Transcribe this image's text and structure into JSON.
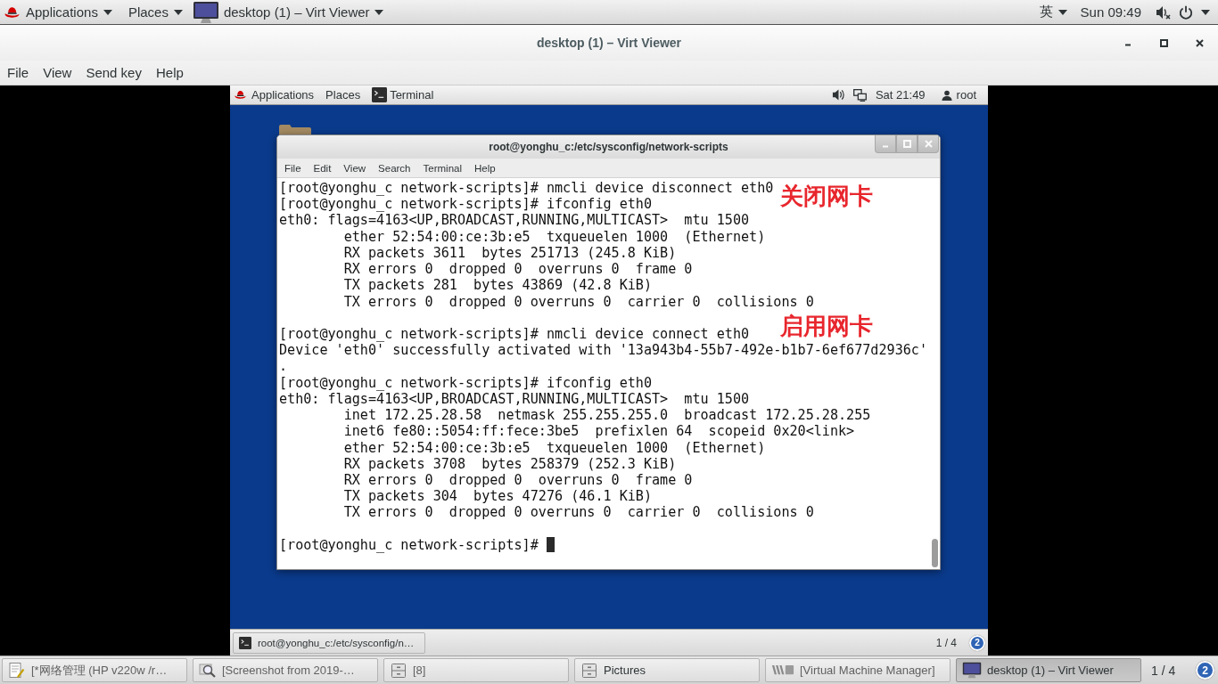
{
  "top_bar": {
    "menus": [
      {
        "label": "Applications"
      },
      {
        "label": "Places"
      }
    ],
    "app_menu": "desktop (1) – Virt Viewer",
    "input_method": "英",
    "clock": "Sun 09:49"
  },
  "window": {
    "title": "desktop (1) – Virt Viewer",
    "menu": [
      "File",
      "View",
      "Send key",
      "Help"
    ]
  },
  "guest": {
    "top_bar": {
      "menus": [
        {
          "label": "Applications"
        },
        {
          "label": "Places"
        }
      ],
      "app_menu": "Terminal",
      "clock": "Sat 21:49",
      "user": "root"
    },
    "terminal": {
      "title": "root@yonghu_c:/etc/sysconfig/network-scripts",
      "menu": [
        "File",
        "Edit",
        "View",
        "Search",
        "Terminal",
        "Help"
      ],
      "blocks": [
        [
          {
            "text": "[root@yonghu_c network-scripts]# nmcli device disconnect eth0"
          },
          {
            "text": "[root@yonghu_c network-scripts]# ifconfig eth0",
            "note": "关闭网卡"
          },
          {
            "text": "eth0: flags=4163<UP,BROADCAST,RUNNING,MULTICAST>  mtu 1500"
          },
          {
            "text": "        ether 52:54:00:ce:3b:e5  txqueuelen 1000  (Ethernet)"
          },
          {
            "text": "        RX packets 3611  bytes 251713 (245.8 KiB)"
          },
          {
            "text": "        RX errors 0  dropped 0  overruns 0  frame 0"
          },
          {
            "text": "        TX packets 281  bytes 43869 (42.8 KiB)"
          },
          {
            "text": "        TX errors 0  dropped 0 overruns 0  carrier 0  collisions 0"
          }
        ],
        [
          {
            "text": "[root@yonghu_c network-scripts]# nmcli device connect eth0",
            "note": "启用网卡"
          },
          {
            "text": "Device 'eth0' successfully activated with '13a943b4-55b7-492e-b1b7-6ef677d2936c'"
          },
          {
            "text": "."
          },
          {
            "text": "[root@yonghu_c network-scripts]# ifconfig eth0"
          },
          {
            "text": "eth0: flags=4163<UP,BROADCAST,RUNNING,MULTICAST>  mtu 1500"
          },
          {
            "text": "        inet 172.25.28.58  netmask 255.255.255.0  broadcast 172.25.28.255"
          },
          {
            "text": "        inet6 fe80::5054:ff:fece:3be5  prefixlen 64  scopeid 0x20<link>"
          },
          {
            "text": "        ether 52:54:00:ce:3b:e5  txqueuelen 1000  (Ethernet)"
          },
          {
            "text": "        RX packets 3708  bytes 258379 (252.3 KiB)"
          },
          {
            "text": "        RX errors 0  dropped 0  overruns 0  frame 0"
          },
          {
            "text": "        TX packets 304  bytes 47276 (46.1 KiB)"
          },
          {
            "text": "        TX errors 0  dropped 0 overruns 0  carrier 0  collisions 0"
          }
        ],
        [
          {
            "text": "[root@yonghu_c network-scripts]#"
          }
        ]
      ]
    },
    "window_list": {
      "items": [
        {
          "label": "root@yonghu_c:/etc/sysconfig/n…",
          "selected": false
        }
      ],
      "workspace": "1 / 4",
      "notifications": "2"
    }
  },
  "taskbar": {
    "items": [
      {
        "kind": "editor",
        "label": "[*网络管理 (HP v220w /r…",
        "minimized": true,
        "selected": false
      },
      {
        "kind": "screenshot",
        "label": "[Screenshot from 2019-…",
        "minimized": true,
        "selected": false
      },
      {
        "kind": "files",
        "label": "[8]",
        "minimized": true,
        "selected": false
      },
      {
        "kind": "files",
        "label": "Pictures",
        "minimized": false,
        "selected": false
      },
      {
        "kind": "vmmanager",
        "label": "[Virtual Machine Manager]",
        "minimized": true,
        "selected": false
      },
      {
        "kind": "viewer",
        "label": "desktop (1) – Virt Viewer",
        "minimized": false,
        "selected": true
      }
    ],
    "workspace": "1 / 4",
    "notifications": "2"
  }
}
